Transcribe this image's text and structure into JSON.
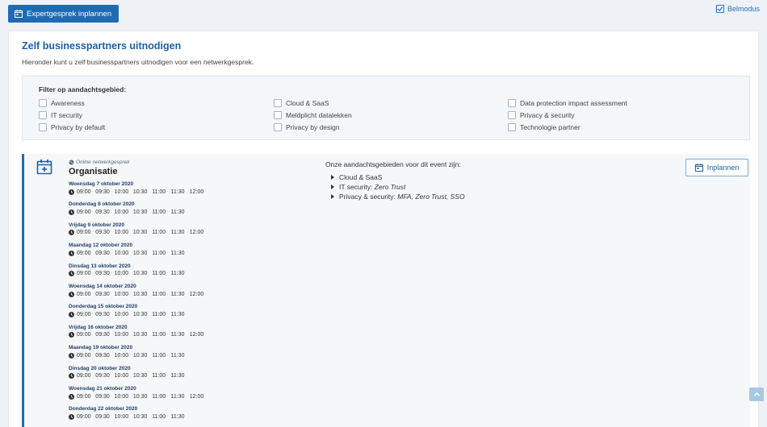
{
  "toolbar": {
    "expert_button_label": "Expertgesprek inplannen",
    "belmodus_label": "Belmodus",
    "belmodus_checked": true
  },
  "panel": {
    "title": "Zelf businesspartners uitnodigen",
    "description": "Hieronder kunt u zelf businesspartners uitnodigen voor een netwerkgesprek."
  },
  "filter": {
    "title": "Filter op aandachtsgebied:",
    "options": [
      "Awareness",
      "IT security",
      "Privacy by default",
      "Cloud & SaaS",
      "Meldplicht datalekken",
      "Privacy by design",
      "Data protection impact assessment",
      "Privacy & security",
      "Technologie partner"
    ]
  },
  "event": {
    "type": "Online netwerkgesprek",
    "name": "Organisatie",
    "inplannen_label": "Inplannen",
    "focus_title": "Onze aandachtsgebieden voor dit event zijn:",
    "focus_areas": [
      {
        "name": "Cloud & SaaS",
        "detail": ""
      },
      {
        "name": "IT security:",
        "detail": "Zero Trust"
      },
      {
        "name": "Privacy & security:",
        "detail": "MFA, Zero Trust, SSO"
      }
    ],
    "days": [
      {
        "date": "Woensdag 7 oktober 2020",
        "slots": [
          "09:00",
          "09:30",
          "10:00",
          "10:30",
          "11:00",
          "11:30",
          "12:00"
        ]
      },
      {
        "date": "Donderdag 8 oktober 2020",
        "slots": [
          "09:00",
          "09:30",
          "10:00",
          "10:30",
          "11:00",
          "11:30"
        ]
      },
      {
        "date": "Vrijdag 9 oktober 2020",
        "slots": [
          "09:00",
          "09:30",
          "10:00",
          "10:30",
          "11:00",
          "11:30",
          "12:00"
        ]
      },
      {
        "date": "Maandag 12 oktober 2020",
        "slots": [
          "09:00",
          "09:30",
          "10:00",
          "10:30",
          "11:00",
          "11:30"
        ]
      },
      {
        "date": "Dinsdag 13 oktober 2020",
        "slots": [
          "09:00",
          "09:30",
          "10:00",
          "10:30",
          "11:00",
          "11:30"
        ]
      },
      {
        "date": "Woensdag 14 oktober 2020",
        "slots": [
          "09:00",
          "09:30",
          "10:00",
          "10:30",
          "11:00",
          "11:30",
          "12:00"
        ]
      },
      {
        "date": "Donderdag 15 oktober 2020",
        "slots": [
          "09:00",
          "09:30",
          "10:00",
          "10:30",
          "11:00",
          "11:30"
        ]
      },
      {
        "date": "Vrijdag 16 oktober 2020",
        "slots": [
          "09:00",
          "09:30",
          "10:00",
          "10:30",
          "11:00",
          "11:30",
          "12:00"
        ]
      },
      {
        "date": "Maandag 19 oktober 2020",
        "slots": [
          "09:00",
          "09:30",
          "10:00",
          "10:30",
          "11:00",
          "11:30"
        ]
      },
      {
        "date": "Dinsdag 20 oktober 2020",
        "slots": [
          "09:00",
          "09:30",
          "10:00",
          "10:30",
          "11:00",
          "11:30"
        ]
      },
      {
        "date": "Woensdag 21 oktober 2020",
        "slots": [
          "09:00",
          "09:30",
          "10:00",
          "10:30",
          "11:00",
          "11:30",
          "12:00"
        ]
      },
      {
        "date": "Donderdag 22 oktober 2020",
        "slots": [
          "09:00",
          "09:30",
          "10:00",
          "10:30",
          "11:00",
          "11:30"
        ]
      }
    ]
  },
  "colors": {
    "brand": "#1f6bb3",
    "title": "#1f5f9f",
    "background": "#eef2f6"
  }
}
